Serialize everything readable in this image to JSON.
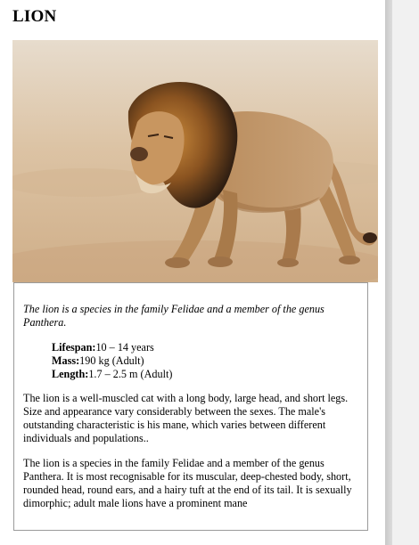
{
  "page": {
    "title": "LION"
  },
  "image": {
    "subject": "lion-photo"
  },
  "card": {
    "intro": "The lion is a species in the family Felidae and a member of the genus Panthera.",
    "facts": [
      {
        "label": "Lifespan:",
        "value": "10 – 14 years"
      },
      {
        "label": "Mass:",
        "value": "190 kg (Adult)"
      },
      {
        "label": "Length:",
        "value": "1.7 – 2.5 m (Adult)"
      }
    ],
    "paragraphs": [
      "The lion is a well-muscled cat with a long body, large head, and short legs. Size and appearance vary considerably between the sexes. The male's outstanding characteristic is his mane, which varies between different individuals and populations..",
      "The lion is a species in the family Felidae and a member of the genus Panthera. It is most recognisable for its muscular, deep-chested body, short, rounded head, round ears, and a hairy tuft at the end of its tail. It is sexually dimorphic; adult male lions have a prominent mane"
    ]
  },
  "colors": {
    "background": "#ffffff",
    "card_border": "#9a9a9a",
    "photo_sand": "#d9c0a2"
  }
}
